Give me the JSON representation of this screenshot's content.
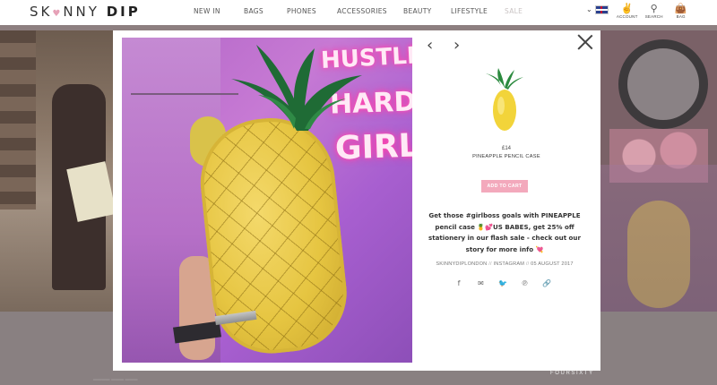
{
  "header": {
    "logo_light": "SK",
    "logo_heart": "♥",
    "logo_light2": "NNY ",
    "logo_bold": "DIP",
    "nav": [
      "NEW IN",
      "BAGS",
      "PHONES",
      "ACCESSORIES",
      "BEAUTY",
      "LIFESTYLE",
      "SALE"
    ],
    "account_label": "ACCOUNT",
    "search_label": "SEARCH",
    "bag_label": "BAG"
  },
  "modal": {
    "photo_neon": [
      "HUSTLE",
      "HARD",
      "GIRL"
    ],
    "price": "£14",
    "product_name": "PINEAPPLE PENCIL CASE",
    "add_to_cart": "ADD TO CART",
    "caption": "Get those #girlboss goals with PINEAPPLE pencil case 🍍💕US BABES, get 25% off stationery in our flash sale - check out our story for more info 💘",
    "meta": {
      "handle": "SKINNYDIPLONDON",
      "separator": "//",
      "source": "INSTAGRAM",
      "date": "05 AUGUST 2017"
    },
    "share_icons": [
      "facebook-icon",
      "email-icon",
      "twitter-icon",
      "pinterest-icon",
      "link-icon"
    ]
  },
  "footer": {
    "brand": "FOURSIXTY"
  },
  "colors": {
    "add_to_cart_bg": "#f3a9bc",
    "overlay_bg": "#8d7f80"
  }
}
